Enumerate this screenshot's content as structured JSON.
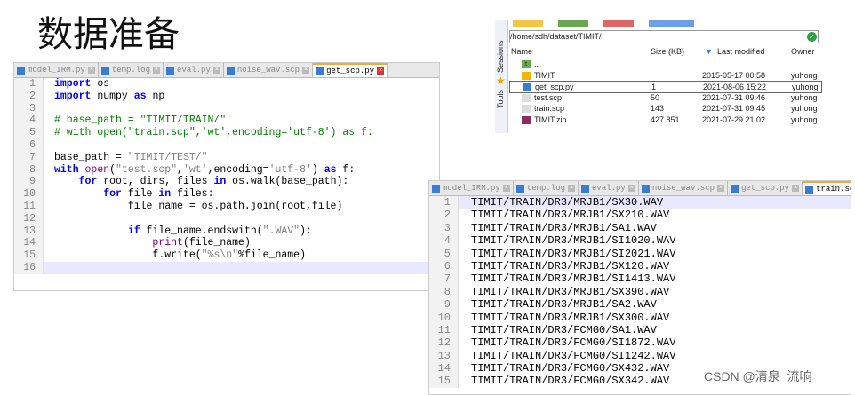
{
  "title": "数据准备",
  "editor1": {
    "tabs": [
      "model_IRM.py",
      "temp.log",
      "eval.py",
      "noise_wav.scp",
      "get_scp.py"
    ],
    "active": 4,
    "lines": [
      [
        [
          "import",
          "kw"
        ],
        [
          " os",
          ""
        ]
      ],
      [
        [
          "import",
          "kw"
        ],
        [
          " numpy ",
          ""
        ],
        [
          "as",
          "kw"
        ],
        [
          " np",
          ""
        ]
      ],
      [],
      [
        [
          "# base_path = \"TIMIT/TRAIN/\"",
          "cm"
        ]
      ],
      [
        [
          "# with open(\"train.scp\",'wt',encoding='utf-8') as f:",
          "cm"
        ]
      ],
      [],
      [
        [
          "base_path = ",
          ""
        ],
        [
          "\"TIMIT/TEST/\"",
          "st"
        ]
      ],
      [
        [
          "with",
          "kw"
        ],
        [
          " ",
          ""
        ],
        [
          "open",
          "fn"
        ],
        [
          "(",
          ""
        ],
        [
          "\"test.scp\"",
          "st"
        ],
        [
          ",",
          ""
        ],
        [
          "'wt'",
          "st"
        ],
        [
          ",encoding=",
          ""
        ],
        [
          "'utf-8'",
          "st"
        ],
        [
          ") ",
          ""
        ],
        [
          "as",
          "kw"
        ],
        [
          " f:",
          ""
        ]
      ],
      [
        [
          "    ",
          ""
        ],
        [
          "for",
          "kw"
        ],
        [
          " root, dirs, files ",
          ""
        ],
        [
          "in",
          "kw"
        ],
        [
          " os.walk(base_path):",
          ""
        ]
      ],
      [
        [
          "        ",
          ""
        ],
        [
          "for",
          "kw"
        ],
        [
          " file ",
          ""
        ],
        [
          "in",
          "kw"
        ],
        [
          " files:",
          ""
        ]
      ],
      [
        [
          "            file_name = os.path.join(root,file)",
          ""
        ]
      ],
      [],
      [
        [
          "            ",
          ""
        ],
        [
          "if",
          "kw"
        ],
        [
          " file_name.endswith(",
          ""
        ],
        [
          "\".WAV\"",
          "st"
        ],
        [
          "):",
          ""
        ]
      ],
      [
        [
          "                ",
          ""
        ],
        [
          "print",
          "fn"
        ],
        [
          "(file_name)",
          ""
        ]
      ],
      [
        [
          "                f.write(",
          ""
        ],
        [
          "\"%s\\n\"",
          "st"
        ],
        [
          "%file_name)",
          ""
        ]
      ],
      []
    ]
  },
  "filemanager": {
    "sidebar": [
      "Sessions",
      "Tools"
    ],
    "path": "/home/sdh/dataset/TIMIT/",
    "columns": [
      "Name",
      "Size (KB)",
      "Last modified",
      "Owner"
    ],
    "rows": [
      {
        "name": "..",
        "size": "",
        "modified": "",
        "owner": "",
        "icon": "parent-dir-icon"
      },
      {
        "name": "TIMIT",
        "size": "",
        "modified": "2015-05-17 00:58",
        "owner": "yuhong",
        "icon": "folder-icon"
      },
      {
        "name": "get_scp.py",
        "size": "1",
        "modified": "2021-08-06 15:22",
        "owner": "yuhong",
        "icon": "python-file-icon"
      },
      {
        "name": "test.scp",
        "size": "50",
        "modified": "2021-07-31 09:46",
        "owner": "yuhong",
        "icon": "file-icon"
      },
      {
        "name": "train.scp",
        "size": "143",
        "modified": "2021-07-31 09:45",
        "owner": "yuhong",
        "icon": "file-icon"
      },
      {
        "name": "TIMIT.zip",
        "size": "427 851",
        "modified": "2021-07-29 21:02",
        "owner": "yuhong",
        "icon": "archive-icon"
      }
    ]
  },
  "editor2": {
    "tabs": [
      "model_IRM.py",
      "temp.log",
      "eval.py",
      "noise_wav.scp",
      "get_scp.py",
      "train.scp"
    ],
    "active": 5,
    "lines": [
      "TIMIT/TRAIN/DR3/MRJB1/SX30.WAV",
      "TIMIT/TRAIN/DR3/MRJB1/SX210.WAV",
      "TIMIT/TRAIN/DR3/MRJB1/SA1.WAV",
      "TIMIT/TRAIN/DR3/MRJB1/SI1020.WAV",
      "TIMIT/TRAIN/DR3/MRJB1/SI2021.WAV",
      "TIMIT/TRAIN/DR3/MRJB1/SX120.WAV",
      "TIMIT/TRAIN/DR3/MRJB1/SI1413.WAV",
      "TIMIT/TRAIN/DR3/MRJB1/SX390.WAV",
      "TIMIT/TRAIN/DR3/MRJB1/SA2.WAV",
      "TIMIT/TRAIN/DR3/MRJB1/SX300.WAV",
      "TIMIT/TRAIN/DR3/FCMG0/SA1.WAV",
      "TIMIT/TRAIN/DR3/FCMG0/SI1872.WAV",
      "TIMIT/TRAIN/DR3/FCMG0/SI1242.WAV",
      "TIMIT/TRAIN/DR3/FCMG0/SX432.WAV",
      "TIMIT/TRAIN/DR3/FCMG0/SX342.WAV"
    ]
  },
  "watermark": "CSDN @清泉_流响"
}
